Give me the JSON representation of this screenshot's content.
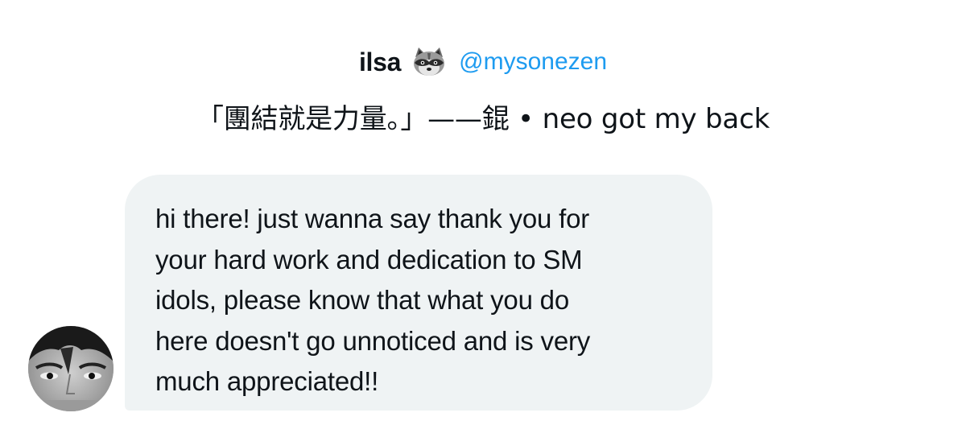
{
  "profile": {
    "display_name": "ilsa",
    "emoji": "raccoon-icon",
    "handle": "@mysonezen",
    "bio": "「團結就是力量。」——錕 • neo got my back"
  },
  "conversation": {
    "message": "hi there! just wanna say thank you for\nyour hard work and dedication to SM\nidols, please know that what you do\nhere doesn't go unnoticed and is very\nmuch appreciated!!"
  },
  "colors": {
    "handle": "#1d9bf0",
    "bubble": "#eff3f4",
    "text": "#0f1419"
  }
}
